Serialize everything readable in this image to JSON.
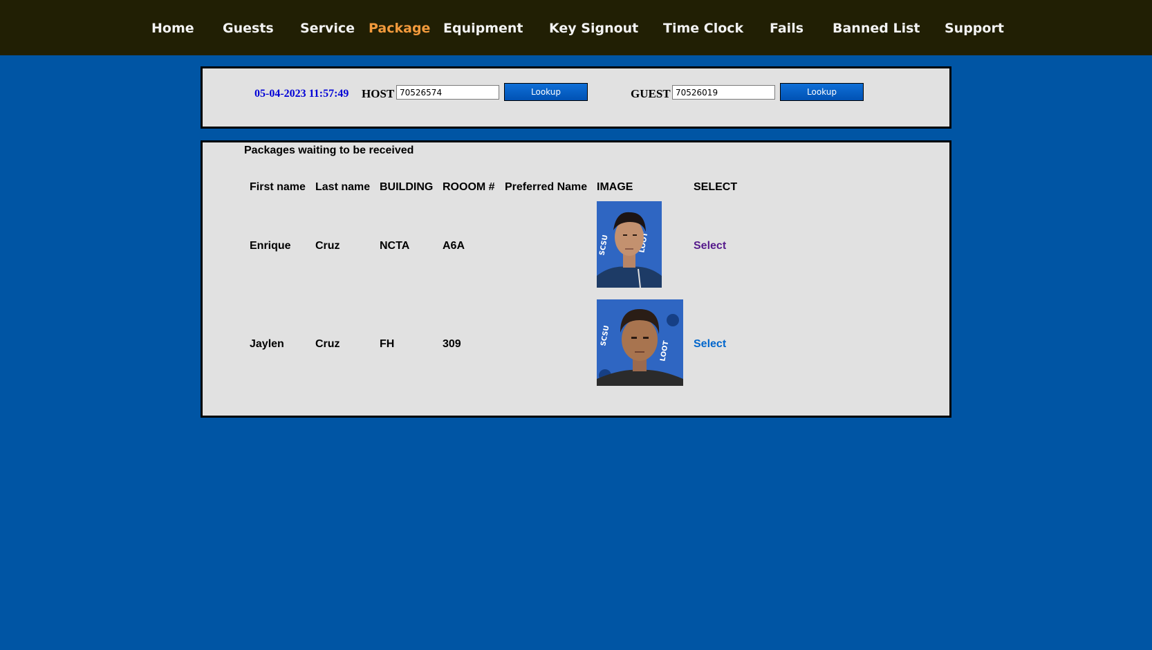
{
  "nav": {
    "items": [
      {
        "label": "Home"
      },
      {
        "label": "Guests"
      },
      {
        "label": "Service"
      },
      {
        "label": "Package"
      },
      {
        "label": "Equipment"
      },
      {
        "label": "Key Signout"
      },
      {
        "label": "Time Clock"
      },
      {
        "label": "Fails"
      },
      {
        "label": "Banned List"
      },
      {
        "label": "Support"
      }
    ],
    "active": "Package",
    "active_color": "#f39a3c"
  },
  "lookup": {
    "datetime": "05-04-2023 11:57:49",
    "host_label": "HOST",
    "host_value": "70526574",
    "guest_label": "GUEST",
    "guest_value": "70526019",
    "button_label": "Lookup"
  },
  "packages": {
    "title": "Packages waiting to be received",
    "columns": [
      "First name",
      "Last name",
      "BUILDING",
      "ROOOM #",
      "Preferred Name",
      "IMAGE",
      "SELECT"
    ],
    "rows": [
      {
        "first": "Enrique",
        "last": "Cruz",
        "building": "NCTA",
        "room": "A6A",
        "preferred": "",
        "select": "Select",
        "select_color": "#551a8b"
      },
      {
        "first": "Jaylen",
        "last": "Cruz",
        "building": "FH",
        "room": "309",
        "preferred": "",
        "select": "Select",
        "select_color": "#0066cc"
      }
    ]
  },
  "colors": {
    "page_background": "#0055a4",
    "nav_background": "#211f04",
    "panel_background": "#e1e1e1",
    "datetime_color": "#0000d6"
  }
}
